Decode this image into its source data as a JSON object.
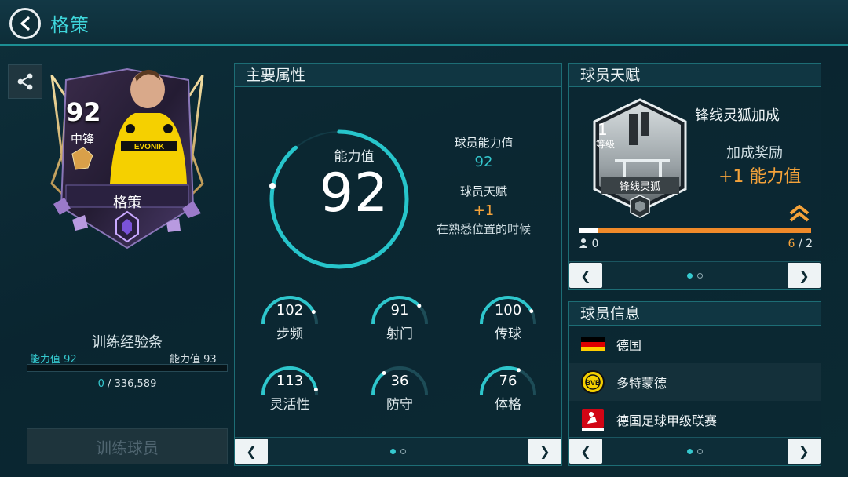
{
  "header": {
    "title": "格策"
  },
  "card": {
    "rating": "92",
    "position": "中锋",
    "name": "格策"
  },
  "training": {
    "title": "训练经验条",
    "current_label": "能力值 92",
    "next_label": "能力值 93",
    "current_xp": "0",
    "separator": " / ",
    "total_xp": "336,589",
    "progress": 0.0,
    "button_label": "训练球员"
  },
  "main_attributes": {
    "title": "主要属性",
    "overall_label": "能力值",
    "overall_value": "92",
    "player_rating_label": "球员能力值",
    "player_rating_value": "92",
    "talent_label": "球员天赋",
    "talent_bonus": "+1",
    "talent_condition": "在熟悉位置的时候",
    "stats": [
      {
        "label": "步频",
        "value": "102",
        "level": 0.85
      },
      {
        "label": "射门",
        "value": "91",
        "level": 0.76
      },
      {
        "label": "传球",
        "value": "100",
        "level": 0.84
      },
      {
        "label": "灵活性",
        "value": "113",
        "level": 0.94
      },
      {
        "label": "防守",
        "value": "36",
        "level": 0.3
      },
      {
        "label": "体格",
        "value": "76",
        "level": 0.63
      }
    ],
    "page_dots": 2,
    "active_dot": 0
  },
  "talent": {
    "title": "球员天赋",
    "level": "1",
    "level_label": "等级",
    "badge_name": "锋线灵狐",
    "talent_name": "锋线灵狐加成",
    "bonus_label": "加成奖励",
    "bonus_value": "+1 能力值",
    "left_count": "0",
    "progress_current": "6",
    "progress_separator": " / ",
    "progress_total": "2"
  },
  "player_info": {
    "title": "球员信息",
    "nation": "德国",
    "club": "多特蒙德",
    "league": "德国足球甲级联赛"
  },
  "colors": {
    "accent": "#35c9cf",
    "orange": "#f4a23a",
    "background": "#0b2a33"
  }
}
